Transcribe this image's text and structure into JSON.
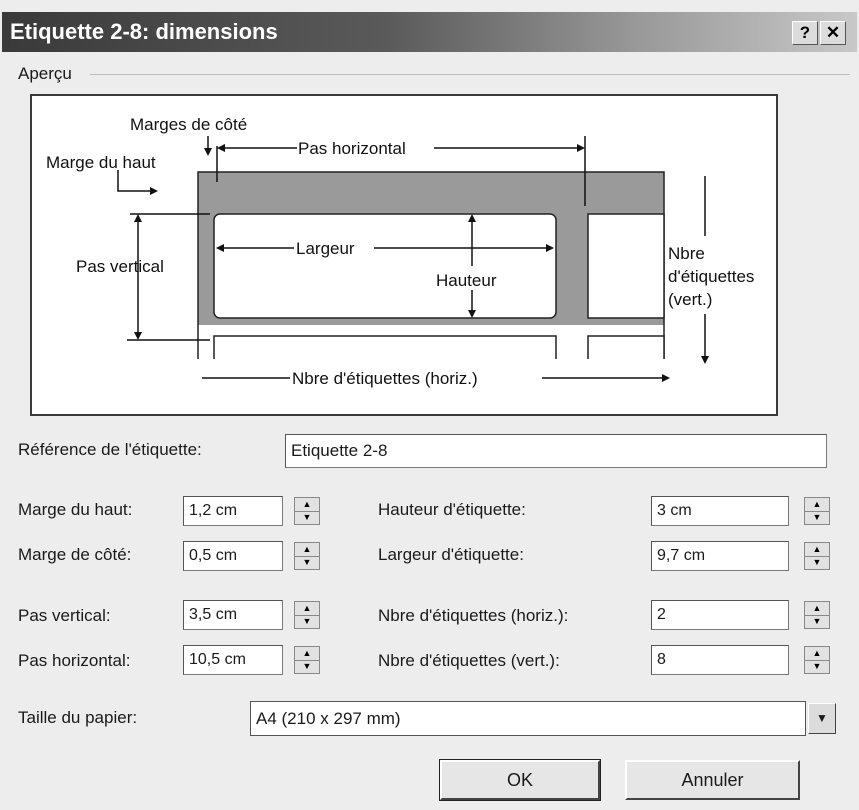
{
  "window": {
    "title": "Etiquette 2-8: dimensions",
    "help_label": "?",
    "close_label": "✕"
  },
  "preview": {
    "group_label": "Aperçu",
    "labels": {
      "marges_cote": "Marges de côté",
      "marge_haut": "Marge du haut",
      "pas_horizontal": "Pas horizontal",
      "pas_vertical": "Pas vertical",
      "largeur": "Largeur",
      "hauteur": "Hauteur",
      "nbre_vert_1": "Nbre",
      "nbre_vert_2": "d'étiquettes",
      "nbre_vert_3": "(vert.)",
      "nbre_horiz": "Nbre d'étiquettes (horiz.)"
    }
  },
  "reference": {
    "label": "Référence de l'étiquette:",
    "value": "Etiquette 2-8"
  },
  "fields": {
    "marge_haut": {
      "label": "Marge du haut:",
      "value": "1,2 cm"
    },
    "marge_cote": {
      "label": "Marge de côté:",
      "value": "0,5 cm"
    },
    "pas_vertical": {
      "label": "Pas vertical:",
      "value": "3,5 cm"
    },
    "pas_horizontal": {
      "label": "Pas horizontal:",
      "value": "10,5 cm"
    },
    "hauteur": {
      "label": "Hauteur d'étiquette:",
      "value": "3 cm"
    },
    "largeur": {
      "label": "Largeur d'étiquette:",
      "value": "9,7 cm"
    },
    "nbre_horiz": {
      "label": "Nbre d'étiquettes (horiz.):",
      "value": "2"
    },
    "nbre_vert": {
      "label": "Nbre d'étiquettes (vert.):",
      "value": "8"
    }
  },
  "paper": {
    "label": "Taille du papier:",
    "value": "A4 (210 x 297 mm)"
  },
  "buttons": {
    "ok": "OK",
    "cancel": "Annuler"
  },
  "spinner_icons": {
    "up": "triangle-up",
    "down": "triangle-down"
  }
}
